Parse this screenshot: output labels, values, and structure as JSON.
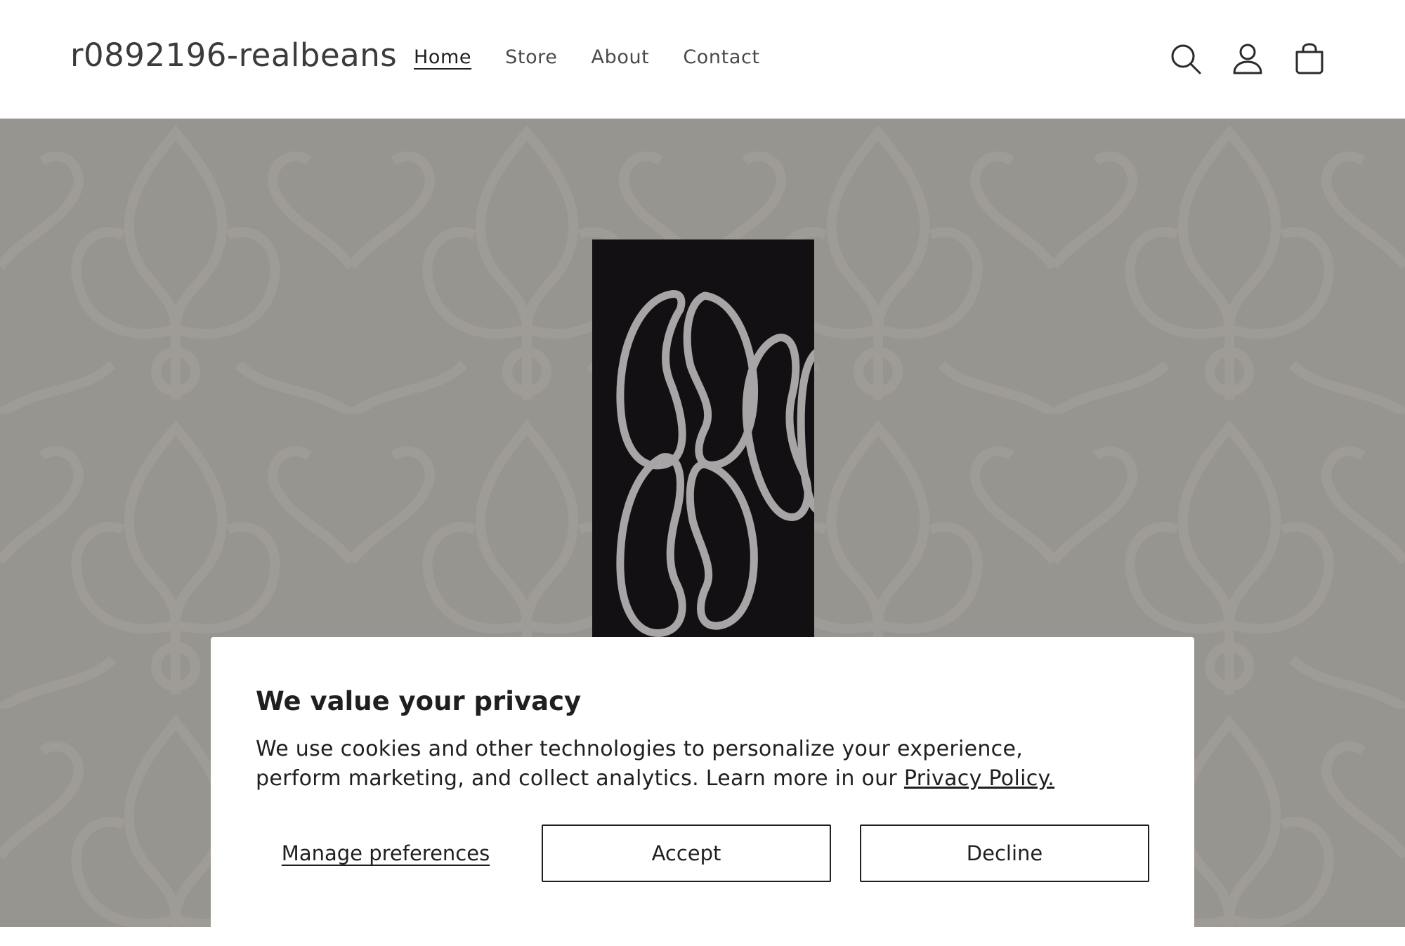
{
  "header": {
    "logo": "r0892196-realbeans",
    "nav": [
      {
        "label": "Home",
        "active": true
      },
      {
        "label": "Store",
        "active": false
      },
      {
        "label": "About",
        "active": false
      },
      {
        "label": "Contact",
        "active": false
      }
    ],
    "icons": [
      "search-icon",
      "account-icon",
      "cart-icon"
    ]
  },
  "hero": {
    "background_color": "#a19e98",
    "image": "coffee-beans-logo-image"
  },
  "cookie_banner": {
    "title": "We value your privacy",
    "body": "We use cookies and other technologies to personalize your experience, perform marketing, and collect analytics. Learn more in our ",
    "policy_link": "Privacy Policy.",
    "manage_label": "Manage preferences",
    "accept_label": "Accept",
    "decline_label": "Decline"
  }
}
